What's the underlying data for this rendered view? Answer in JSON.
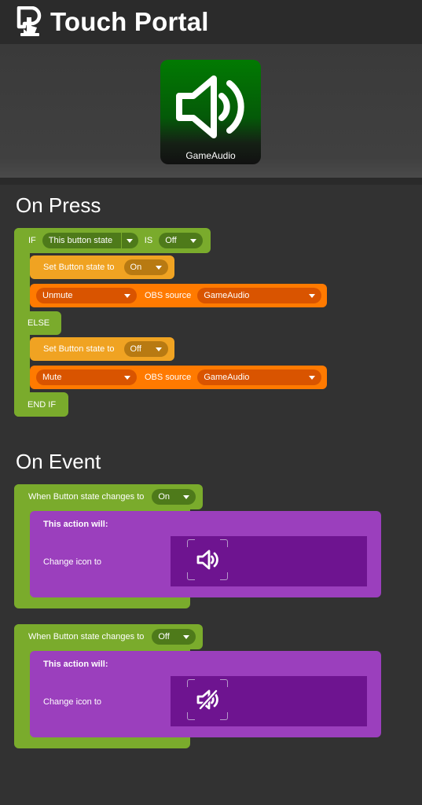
{
  "header": {
    "title": "Touch Portal",
    "logo_icon": "touch-portal-logo"
  },
  "preview": {
    "tile_label": "GameAudio",
    "tile_icon": "speaker-icon",
    "tile_color": "#027a02"
  },
  "on_press": {
    "heading": "On Press",
    "if_label": "IF",
    "condition_value": "This button state",
    "is_label": "IS",
    "compare_value": "Off",
    "then_set_label": "Set Button state to",
    "then_set_value": "On",
    "then_action_value": "Unmute",
    "then_source_label": "OBS source",
    "then_source_value": "GameAudio",
    "else_label": "ELSE",
    "else_set_label": "Set Button state to",
    "else_set_value": "Off",
    "else_action_value": "Mute",
    "else_source_label": "OBS source",
    "else_source_value": "GameAudio",
    "endif_label": "END IF"
  },
  "on_event": {
    "heading": "On Event",
    "events": [
      {
        "when_label": "When Button state changes to",
        "value": "On",
        "action_title": "This action will:",
        "action_label": "Change icon to",
        "icon": "speaker-icon"
      },
      {
        "when_label": "When Button state changes to",
        "value": "Off",
        "action_title": "This action will:",
        "action_label": "Change icon to",
        "icon": "speaker-muted-icon"
      }
    ]
  },
  "colors": {
    "logic_green": "#7aab2c",
    "state_amber": "#f0a322",
    "obs_orange": "#ff7a00",
    "action_purple": "#9b3fbd"
  }
}
